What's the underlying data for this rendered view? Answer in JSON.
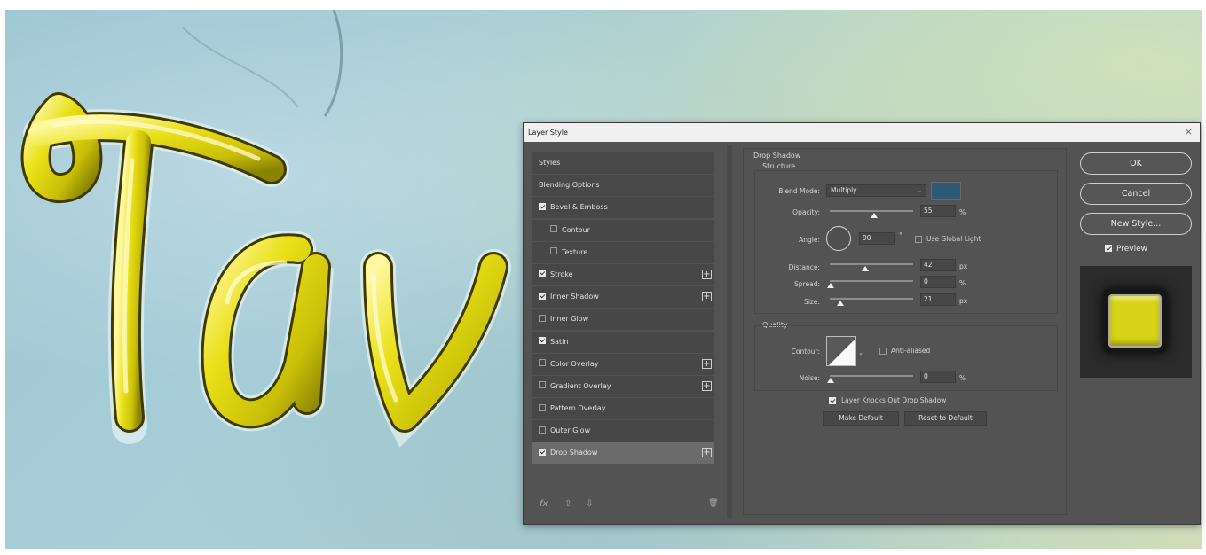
{
  "dialog": {
    "title": "Layer Style",
    "close": "×"
  },
  "styles_list": {
    "items": [
      {
        "label": "Styles"
      },
      {
        "label": "Blending Options"
      },
      {
        "label": "Bevel & Emboss",
        "checked": true
      },
      {
        "label": "Contour",
        "checked": false
      },
      {
        "label": "Texture",
        "checked": false
      },
      {
        "label": "Stroke",
        "checked": true,
        "add": "+"
      },
      {
        "label": "Inner Shadow",
        "checked": true,
        "add": "+"
      },
      {
        "label": "Inner Glow",
        "checked": false
      },
      {
        "label": "Satin",
        "checked": true
      },
      {
        "label": "Color Overlay",
        "checked": false,
        "add": "+"
      },
      {
        "label": "Gradient Overlay",
        "checked": false,
        "add": "+"
      },
      {
        "label": "Pattern Overlay",
        "checked": false
      },
      {
        "label": "Outer Glow",
        "checked": false
      },
      {
        "label": "Drop Shadow",
        "checked": true,
        "add": "+",
        "selected": true
      }
    ],
    "footer": {
      "fx": "fx",
      "up": "⇧",
      "down": "⇩",
      "trash": "🗑"
    }
  },
  "drop_shadow": {
    "heading": "Drop Shadow",
    "structure": {
      "heading": "Structure",
      "blend_mode_label": "Blend Mode:",
      "blend_mode": "Multiply",
      "shadow_color": "#2e5a73",
      "opacity_label": "Opacity:",
      "opacity": "55",
      "opacity_unit": "%",
      "angle_label": "Angle:",
      "angle": "90",
      "angle_unit": "°",
      "use_global_light": "Use Global Light",
      "use_global_light_checked": false,
      "distance_label": "Distance:",
      "distance": "42",
      "distance_unit": "px",
      "spread_label": "Spread:",
      "spread": "0",
      "spread_unit": "%",
      "size_label": "Size:",
      "size": "21",
      "size_unit": "px"
    },
    "quality": {
      "heading": "Quality",
      "contour_label": "Contour:",
      "anti_aliased": "Anti-aliased",
      "anti_aliased_checked": false,
      "noise_label": "Noise:",
      "noise": "0",
      "noise_unit": "%"
    },
    "layer_knocks_out": "Layer Knocks Out Drop Shadow",
    "layer_knocks_out_checked": true,
    "make_default": "Make Default",
    "reset_to_default": "Reset to Default"
  },
  "actions": {
    "ok": "OK",
    "cancel": "Cancel",
    "new_style": "New Style...",
    "preview": "Preview",
    "preview_checked": true
  },
  "colors": {
    "dialog_bg": "#535353",
    "text_yellow": "#e1db12",
    "preview_fill": "#d6d319"
  }
}
